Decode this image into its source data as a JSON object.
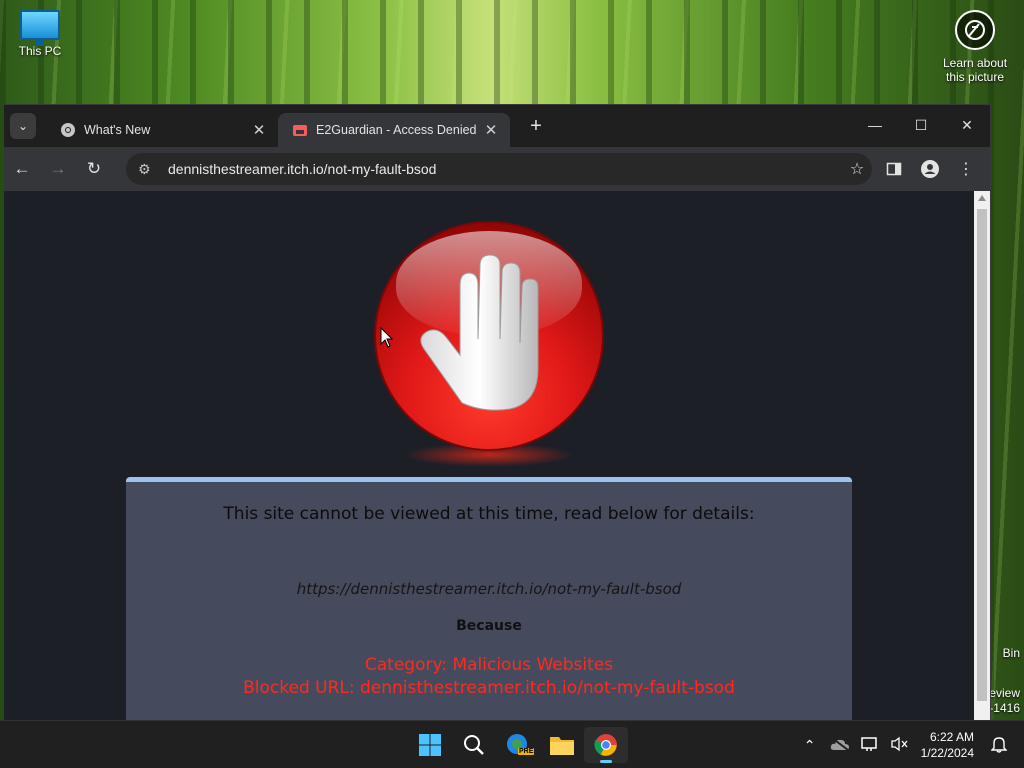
{
  "desktop": {
    "this_pc_label": "This PC",
    "learn_label_1": "Learn about",
    "learn_label_2": "this picture",
    "peek_bin": "Bin",
    "peek_review": "eview",
    "peek_build": "-1416"
  },
  "browser": {
    "tabs": [
      {
        "title": "What's New",
        "icon": "chrome-icon",
        "active": false
      },
      {
        "title": "E2Guardian - Access Denied",
        "icon": "itchio-icon",
        "active": true
      }
    ],
    "address": "dennisthestreamer.itch.io/not-my-fault-bsod"
  },
  "page": {
    "heading": "This site cannot be viewed at this time, read below for details:",
    "blocked_full_url": "https://dennisthestreamer.itch.io/not-my-fault-bsod",
    "because": "Because",
    "category": "Category: Malicious Websites",
    "blocked_url_line": "Blocked URL: dennisthestreamer.itch.io/not-my-fault-bsod"
  },
  "taskbar": {
    "apps": [
      "windows-start-icon",
      "search-icon",
      "edge-beta-icon",
      "file-explorer-icon",
      "chrome-icon"
    ],
    "edge_badge": "PRE",
    "time": "6:22 AM",
    "date": "1/22/2024"
  },
  "colors": {
    "blocked_red": "#ff2a1f",
    "panel_bg": "#454a5c",
    "panel_border": "#9ac3ee",
    "page_bg": "#1d1f27"
  }
}
